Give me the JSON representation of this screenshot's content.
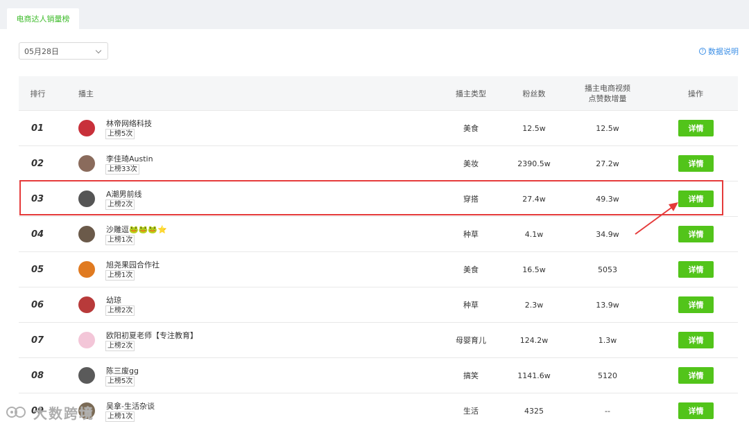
{
  "tabs": {
    "active_label": "电商达人销量榜"
  },
  "date_filter": {
    "value": "05月28日"
  },
  "help_link": {
    "label": "数据说明"
  },
  "table": {
    "headers": {
      "rank": "排行",
      "anchor": "播主",
      "type": "播主类型",
      "fans": "粉丝数",
      "likes_line1": "播主电商视频",
      "likes_line2": "点赞数增量",
      "action": "操作"
    },
    "action_label": "详情",
    "rows": [
      {
        "rank": "01",
        "name": "林帝网络科技",
        "badge": "上榜5次",
        "type": "美食",
        "fans": "12.5w",
        "likes": "12.5w"
      },
      {
        "rank": "02",
        "name": "李佳琦Austin",
        "badge": "上榜33次",
        "type": "美妆",
        "fans": "2390.5w",
        "likes": "27.2w"
      },
      {
        "rank": "03",
        "name": "A潮男前线",
        "badge": "上榜2次",
        "type": "穿搭",
        "fans": "27.4w",
        "likes": "49.3w"
      },
      {
        "rank": "04",
        "name": "沙雕逗🐸🐸🐸⭐",
        "badge": "上榜1次",
        "type": "种草",
        "fans": "4.1w",
        "likes": "34.9w"
      },
      {
        "rank": "05",
        "name": "旭尧果园合作社",
        "badge": "上榜1次",
        "type": "美食",
        "fans": "16.5w",
        "likes": "5053"
      },
      {
        "rank": "06",
        "name": "幼琼",
        "badge": "上榜2次",
        "type": "种草",
        "fans": "2.3w",
        "likes": "13.9w"
      },
      {
        "rank": "07",
        "name": "欧阳初夏老师【专注教育】",
        "badge": "上榜2次",
        "type": "母婴育儿",
        "fans": "124.2w",
        "likes": "1.3w"
      },
      {
        "rank": "08",
        "name": "陈三废gg",
        "badge": "上榜5次",
        "type": "搞笑",
        "fans": "1141.6w",
        "likes": "5120"
      },
      {
        "rank": "09",
        "name": "吴拿-生活杂谈",
        "badge": "上榜1次",
        "type": "生活",
        "fans": "4325",
        "likes": "--"
      }
    ]
  },
  "avatar_colors": [
    "#c8303a",
    "#8a6b5c",
    "#555555",
    "#6b5a4a",
    "#e07a20",
    "#b83a3a",
    "#f3c6d8",
    "#5a5a5a",
    "#7a6a55"
  ],
  "accent_colors": {
    "green": "#52c41a",
    "highlight_red": "#e53a3a",
    "tab_green": "#3dbb2a"
  },
  "watermark": {
    "text": "大数跨境"
  }
}
